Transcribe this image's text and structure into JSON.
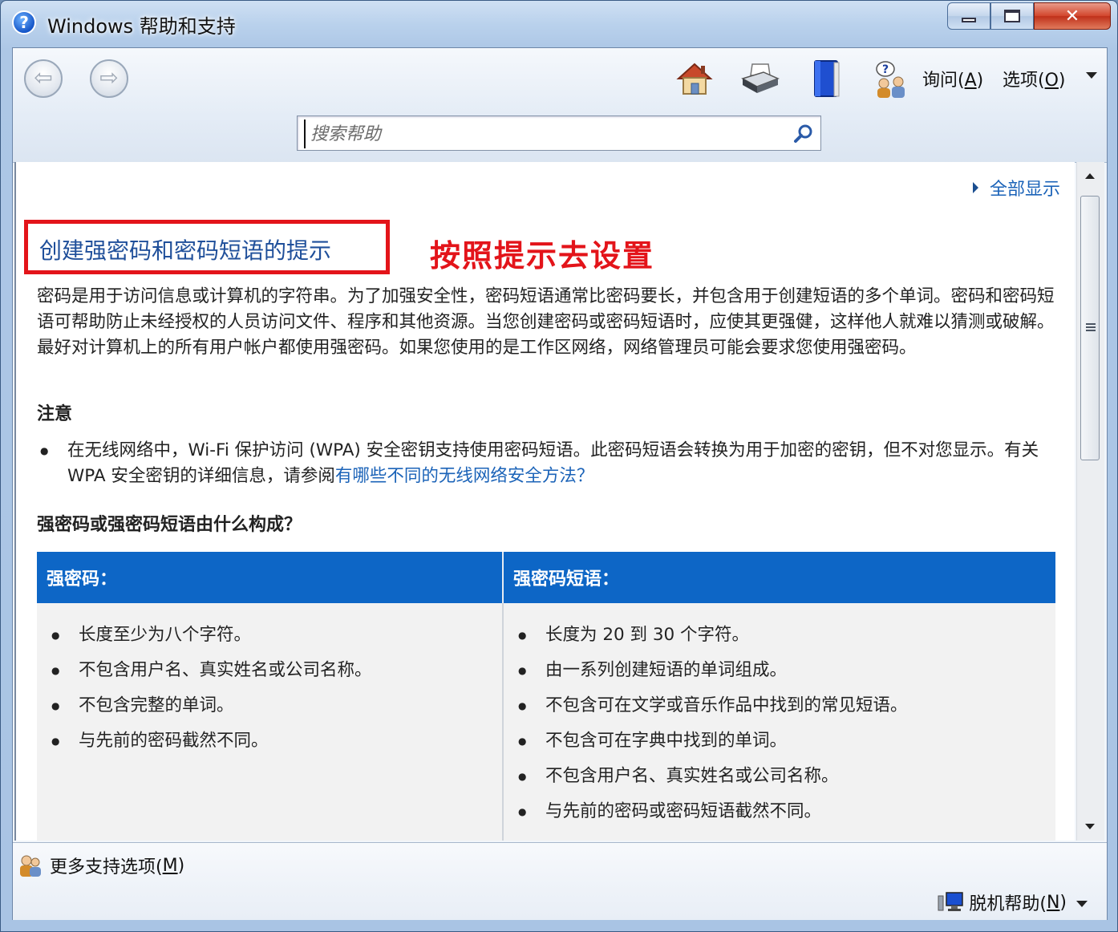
{
  "window": {
    "title": "Windows 帮助和支持",
    "title_icon_glyph": "?",
    "close_glyph": "✕"
  },
  "toolbar": {
    "back_glyph": "⇦",
    "forward_glyph": "⇨",
    "icons": [
      "home-icon",
      "print-icon",
      "browse-help-icon",
      "ask-icon"
    ],
    "ask_label": "询问(",
    "ask_key": "A",
    "ask_suffix": ")",
    "options_label": "选项(",
    "options_key": "O",
    "options_suffix": ")"
  },
  "search": {
    "placeholder": "搜索帮助"
  },
  "content": {
    "show_all": "全部显示",
    "page_title": "创建强密码和密码短语的提示",
    "annotation": "按照提示去设置",
    "intro": "密码是用于访问信息或计算机的字符串。为了加强安全性，密码短语通常比密码要长，并包含用于创建短语的多个单词。密码和密码短语可帮助防止未经授权的人员访问文件、程序和其他资源。当您创建密码或密码短语时，应使其更强健，这样他人就难以猜测或破解。最好对计算机上的所有用户帐户都使用强密码。如果您使用的是工作区网络，网络管理员可能会要求您使用强密码。",
    "note_heading": "注意",
    "note_text": "在无线网络中，Wi-Fi 保护访问 (WPA) 安全密钥支持使用密码短语。此密码短语会转换为用于加密的密钥，但不对您显示。有关 WPA 安全密钥的详细信息，请参阅",
    "note_link": "有哪些不同的无线网络安全方法？",
    "sub_heading": "强密码或强密码短语由什么构成？",
    "table": {
      "col1_header": "强密码：",
      "col2_header": "强密码短语：",
      "col1_items": [
        "长度至少为八个字符。",
        "不包含用户名、真实姓名或公司名称。",
        "不包含完整的单词。",
        "与先前的密码截然不同。"
      ],
      "col2_items": [
        "长度为 20 到 30 个字符。",
        "由一系列创建短语的单词组成。",
        "不包含可在文学或音乐作品中找到的常见短语。",
        "不包含可在字典中找到的单词。",
        "不包含用户名、真实姓名或公司名称。",
        "与先前的密码或密码短语截然不同。"
      ]
    }
  },
  "status": {
    "more_support_label": "更多支持选项(",
    "more_support_key": "M",
    "more_support_suffix": ")",
    "offline_label": "脱机帮助(",
    "offline_key": "N",
    "offline_suffix": ")"
  },
  "colors": {
    "accent": "#0d66c6",
    "link": "#1b63b8",
    "annotation_red": "#e3141a",
    "title_blue": "#1f4f9a"
  }
}
